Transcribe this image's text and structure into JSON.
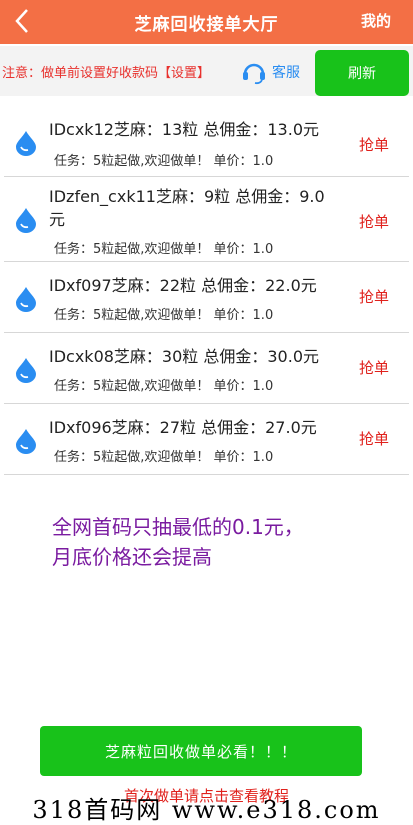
{
  "header": {
    "back_icon": "chevron-left-icon",
    "title": "芝麻回收接单大厅",
    "mine_label": "我的"
  },
  "notice": {
    "text": "注意：做单前设置好收款码【设置】",
    "service_icon": "headset-icon",
    "service_label": "客服",
    "refresh_label": "刷新"
  },
  "orders": [
    {
      "line1": "IDcxk12芝麻：13粒 总佣金：13.0元",
      "line2": "任务：5粒起做,欢迎做单！ 单价：1.0",
      "action": "抢单"
    },
    {
      "line1a": "IDzfen_cxk11芝麻：9粒 总佣金：9.0",
      "line1b": "元",
      "line2": "任务：5粒起做,欢迎做单！ 单价：1.0",
      "action": "抢单"
    },
    {
      "line1": "IDxf097芝麻：22粒 总佣金：22.0元",
      "line2": "任务：5粒起做,欢迎做单！ 单价：1.0",
      "action": "抢单"
    },
    {
      "line1": "IDcxk08芝麻：30粒 总佣金：30.0元",
      "line2": "任务：5粒起做,欢迎做单！ 单价：1.0",
      "action": "抢单"
    },
    {
      "line1": "IDxf096芝麻：27粒 总佣金：27.0元",
      "line2": "任务：5粒起做,欢迎做单！ 单价：1.0",
      "action": "抢单"
    }
  ],
  "promo": {
    "line1": "全网首码只抽最低的0.1元，",
    "line2": "月底价格还会提高"
  },
  "footer": {
    "guide_button": "芝麻粒回收做单必看！！！",
    "tutorial_link": "首次做单请点击查看教程",
    "watermark": "318首码网  www.e318.com"
  },
  "colors": {
    "header": "#f36f45",
    "green": "#18c21a",
    "red": "#e0211c",
    "purple": "#7a1ba0",
    "blue": "#2a8df1"
  }
}
